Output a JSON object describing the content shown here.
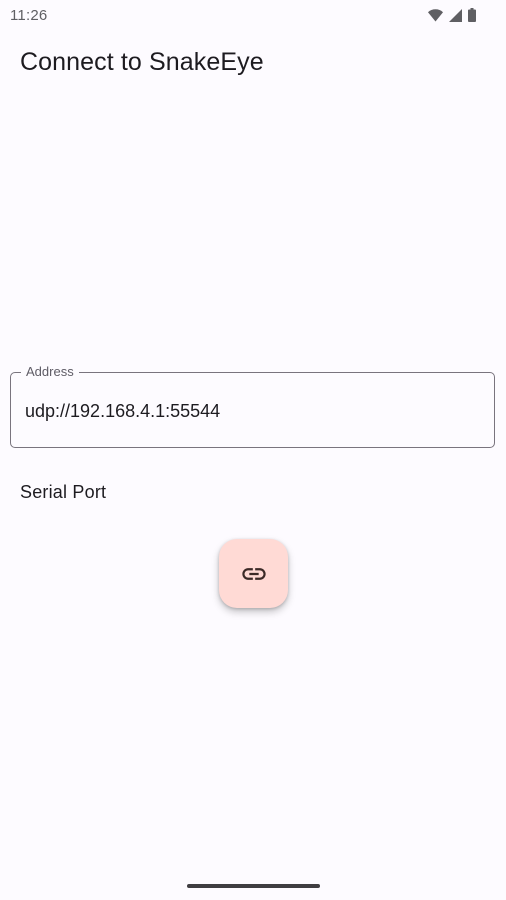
{
  "status_bar": {
    "time": "11:26",
    "icons": [
      "wifi-icon",
      "cell-signal-icon",
      "battery-icon"
    ]
  },
  "header": {
    "title": "Connect to SnakeEye"
  },
  "form": {
    "address": {
      "label": "Address",
      "value": "udp://192.168.4.1:55544"
    },
    "serial_port_label": "Serial Port"
  },
  "fab": {
    "icon": "link-icon",
    "color": "#ffdad5"
  },
  "colors": {
    "background": "#fdfbff",
    "text": "#1d1b20",
    "outline": "#79747e"
  }
}
